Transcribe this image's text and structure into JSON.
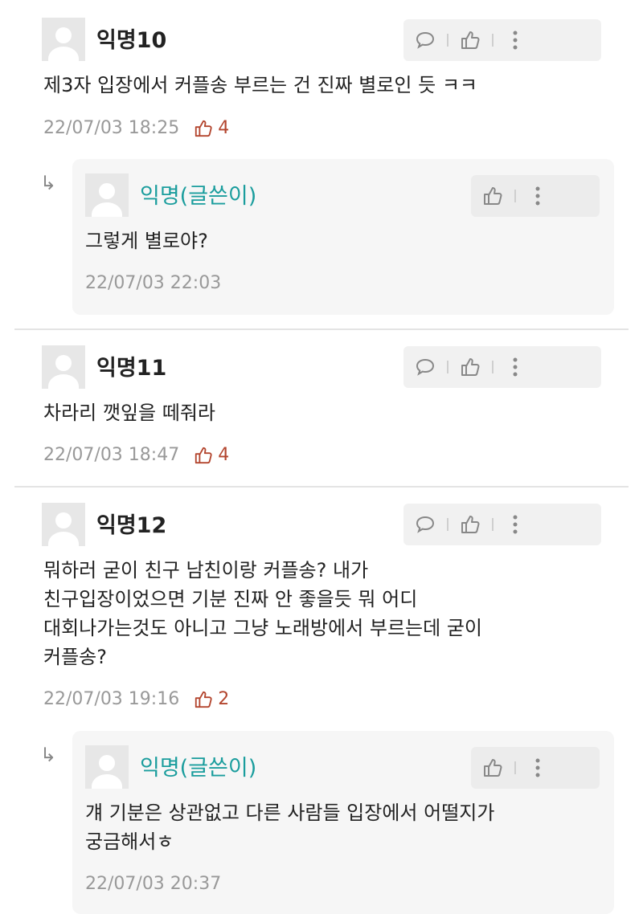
{
  "comments": [
    {
      "name": "익명10",
      "text_lines": [
        "제3자 입장에서 커플송 부르는 건 진짜 별로인 듯 ㅋㅋ"
      ],
      "date": "22/07/03 18:25",
      "likes": "4",
      "reply": {
        "name": "익명(글쓴이)",
        "text_lines": [
          "그렇게 별로야?"
        ],
        "date": "22/07/03 22:03"
      }
    },
    {
      "name": "익명11",
      "text_lines": [
        "차라리 깻잎을 떼줘라"
      ],
      "date": "22/07/03 18:47",
      "likes": "4"
    },
    {
      "name": "익명12",
      "text_lines": [
        "뭐하러 굳이 친구 남친이랑 커플송? 내가",
        "친구입장이었으면 기분 진짜 안 좋을듯 뭐 어디",
        "대회나가는것도 아니고 그냥 노래방에서 부르는데 굳이",
        "커플송?"
      ],
      "date": "22/07/03 19:16",
      "likes": "2",
      "reply": {
        "name": "익명(글쓴이)",
        "text_lines": [
          "걔 기분은 상관없고 다른 사람들 입장에서 어떨지가",
          "궁금해서ㅎ"
        ],
        "date": "22/07/03 20:37"
      }
    }
  ],
  "icons": {
    "comment": "speech-bubble-icon",
    "like": "thumbs-up-icon",
    "more": "more-vertical-icon",
    "reply_arrow": "reply-arrow-icon",
    "avatar": "default-avatar-icon"
  },
  "colors": {
    "author_name": "#1a9d9d",
    "like_count": "#b3452e",
    "meta": "#999999",
    "reply_bg": "#f6f6f6",
    "action_bg": "#f1f1f1"
  },
  "reply_arrow_glyph": "↳"
}
